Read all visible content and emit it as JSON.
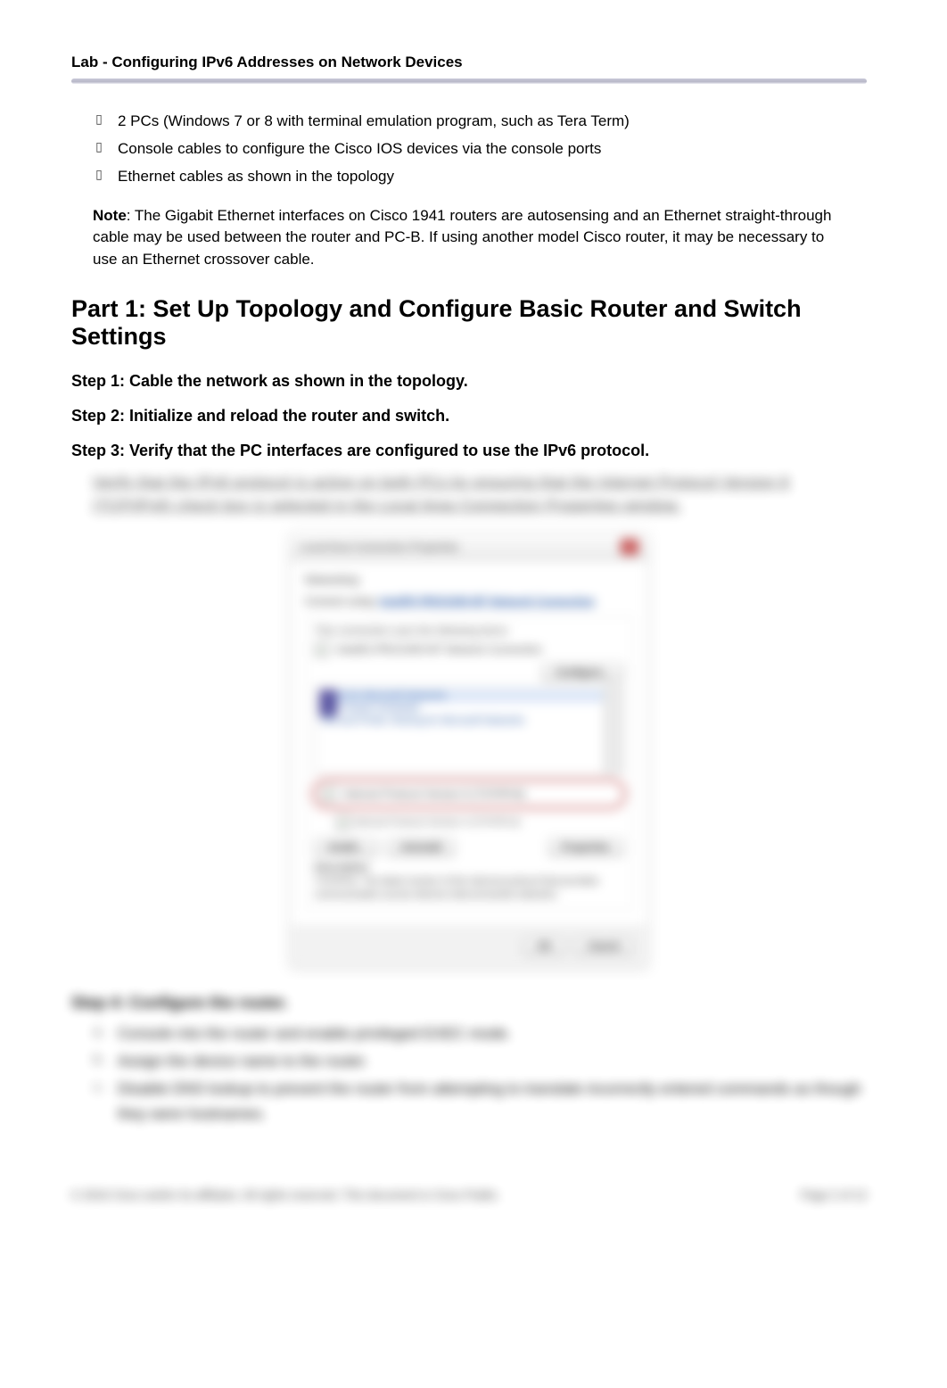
{
  "header": {
    "title": "Lab - Configuring IPv6 Addresses on Network Devices"
  },
  "bullets": [
    "2 PCs (Windows 7 or 8 with terminal emulation program, such as Tera Term)",
    "Console cables to configure the Cisco IOS devices via the console ports",
    "Ethernet cables as shown in the topology"
  ],
  "note": {
    "label": "Note",
    "text": ": The Gigabit Ethernet interfaces on Cisco 1941 routers are autosensing and an Ethernet straight-through cable may be used between the router and PC-B. If using another model Cisco router, it may be necessary to use an Ethernet crossover cable."
  },
  "part_heading": "Part 1:   Set Up Topology and Configure Basic Router and Switch Settings",
  "steps": {
    "s1": "Step 1:   Cable the network as shown in the topology.",
    "s2": "Step 2:   Initialize and reload the router and switch.",
    "s3": "Step 3:   Verify that the PC interfaces are configured to use the IPv6 protocol."
  },
  "blur": {
    "intro": "Verify that the IPv6 protocol is active on both PCs by ensuring that the Internet Protocol Version 6 (TCP/IPv6) check box is selected in the Local Area Connection Properties window.",
    "screenshot": {
      "title": "Local Area Connection Properties",
      "tab": "Networking",
      "connect_label": "Connect using:",
      "adapter": "Intel(R) PRO/1000 MT Network Connection",
      "configure": "Configure...",
      "uses_label": "This connection uses the following items:",
      "items": [
        "Client for Microsoft Networks",
        "QoS Packet Scheduler",
        "File and Printer Sharing for Microsoft Networks"
      ],
      "ipv6_item": "Internet Protocol Version 6 (TCP/IPv6)",
      "ipv4_item": "Internet Protocol Version 4 (TCP/IPv4)",
      "install": "Install...",
      "uninstall": "Uninstall",
      "properties": "Properties",
      "desc_label": "Description",
      "desc_text": "TCP/IPv6. The latest version of the internet protocol that provides communication across diverse interconnected networks.",
      "ok": "OK",
      "cancel": "Cancel"
    },
    "step4": "Step 4:   Configure the router.",
    "sub": {
      "a": "Console into the router and enable privileged EXEC mode.",
      "b": "Assign the device name to the router.",
      "c": "Disable DNS lookup to prevent the router from attempting to translate incorrectly entered commands as though they were hostnames."
    }
  },
  "footer": {
    "copyright": "© 2016 Cisco and/or its affiliates. All rights reserved. This document is Cisco Public.",
    "page": "Page 2 of 12"
  }
}
